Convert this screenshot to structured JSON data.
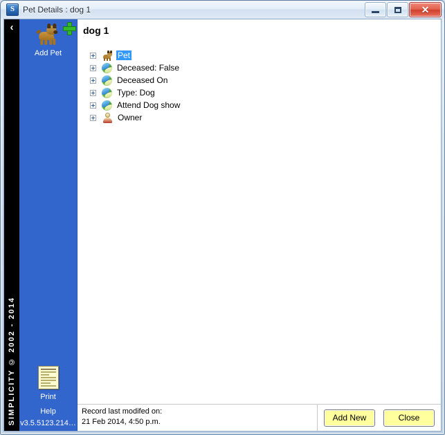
{
  "window": {
    "title": "Pet Details : dog 1",
    "app_icon": "S",
    "icon_name": "simplicity-app-icon",
    "minimize_label": "",
    "maximize_label": "",
    "close_label": "✕"
  },
  "strip": {
    "collapse_icon": "‹",
    "copyright": "SIMPLICITY © 2002 - 2014"
  },
  "sidebar": {
    "add_pet_label": "Add Pet",
    "print_label": "Print",
    "help_label": "Help",
    "version": "v3.5.5123.214…",
    "accent_color": "#3366cc"
  },
  "main": {
    "page_title": "dog 1",
    "tree": [
      {
        "label": "Pet",
        "icon": "dog-icon",
        "selected": true,
        "expandable": true
      },
      {
        "label": "Deceased:  False",
        "icon": "attribute-icon",
        "selected": false,
        "expandable": true
      },
      {
        "label": "Deceased On",
        "icon": "attribute-icon",
        "selected": false,
        "expandable": true
      },
      {
        "label": "Type:  Dog",
        "icon": "attribute-icon",
        "selected": false,
        "expandable": true
      },
      {
        "label": "Attend Dog show",
        "icon": "attribute-icon",
        "selected": false,
        "expandable": true
      },
      {
        "label": "Owner",
        "icon": "person-icon",
        "selected": false,
        "expandable": true
      }
    ]
  },
  "footer": {
    "modified_caption": "Record last modifed on:",
    "modified_value": "21 Feb 2014, 4:50 p.m.",
    "add_new_label": "Add New",
    "close_label": "Close",
    "button_color": "#ffff9e"
  }
}
